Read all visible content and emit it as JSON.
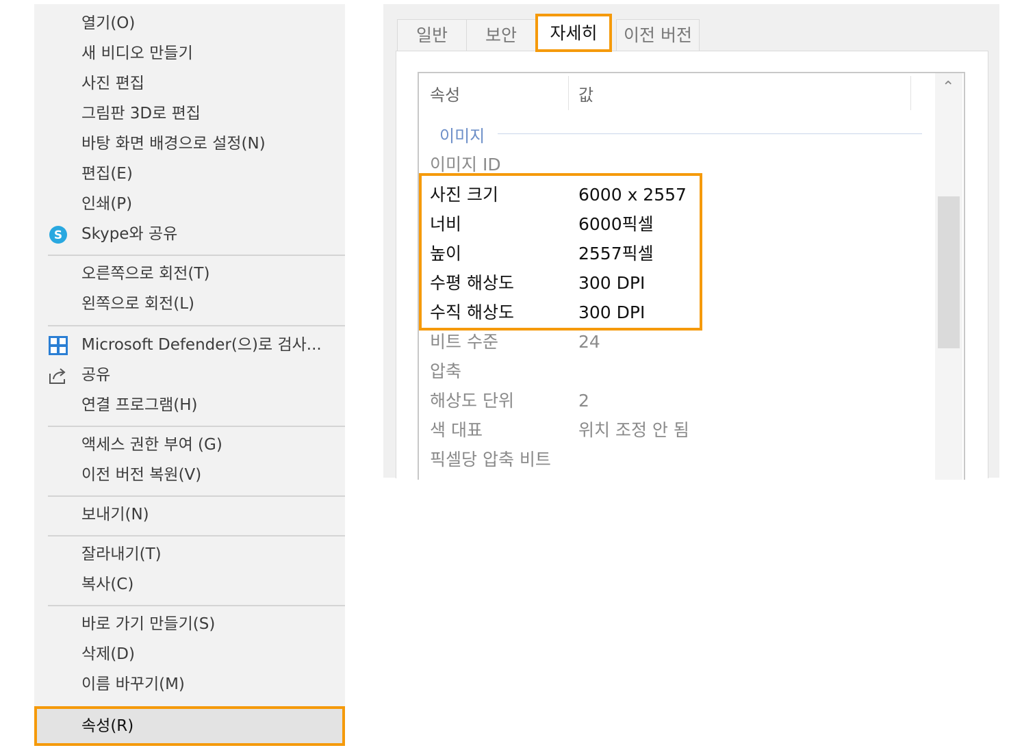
{
  "context_menu": {
    "items": [
      {
        "label": "열기(O)"
      },
      {
        "label": "새 비디오 만들기"
      },
      {
        "label": "사진 편집"
      },
      {
        "label": "그림판 3D로 편집"
      },
      {
        "label": "바탕 화면 배경으로 설정(N)"
      },
      {
        "label": "편집(E)"
      },
      {
        "label": "인쇄(P)"
      },
      {
        "label": "Skype와 공유",
        "icon": "skype-icon"
      },
      {
        "label": "오른쪽으로 회전(T)"
      },
      {
        "label": "왼쪽으로 회전(L)"
      },
      {
        "label": "Microsoft Defender(으)로 검사...",
        "icon": "defender-shield-icon"
      },
      {
        "label": "공유",
        "icon": "share-icon"
      },
      {
        "label": "연결 프로그램(H)"
      },
      {
        "label": "액세스 권한 부여 (G)"
      },
      {
        "label": "이전 버전 복원(V)"
      },
      {
        "label": "보내기(N)"
      },
      {
        "label": "잘라내기(T)"
      },
      {
        "label": "복사(C)"
      },
      {
        "label": "바로 가기 만들기(S)"
      },
      {
        "label": "삭제(D)"
      },
      {
        "label": "이름 바꾸기(M)"
      },
      {
        "label": "속성(R)"
      }
    ]
  },
  "dialog": {
    "tabs": [
      {
        "label": "일반"
      },
      {
        "label": "보안"
      },
      {
        "label": "자세히"
      },
      {
        "label": "이전 버전"
      }
    ],
    "columns": {
      "property": "속성",
      "value": "값"
    },
    "group": "이미지",
    "rows": [
      {
        "k": "이미지 ID",
        "v": ""
      },
      {
        "k": "사진 크기",
        "v": "6000 x 2557"
      },
      {
        "k": "너비",
        "v": "6000픽셀"
      },
      {
        "k": "높이",
        "v": "2557픽셀"
      },
      {
        "k": "수평 해상도",
        "v": "300 DPI"
      },
      {
        "k": "수직 해상도",
        "v": "300 DPI"
      },
      {
        "k": "비트 수준",
        "v": "24"
      },
      {
        "k": "압축",
        "v": ""
      },
      {
        "k": "해상도 단위",
        "v": "2"
      },
      {
        "k": "색 대표",
        "v": "위치 조정 안 됨"
      },
      {
        "k": "픽셀당 압축 비트",
        "v": ""
      }
    ]
  },
  "colors": {
    "highlight": "#f59a0b",
    "group_text": "#6d8fc8"
  }
}
